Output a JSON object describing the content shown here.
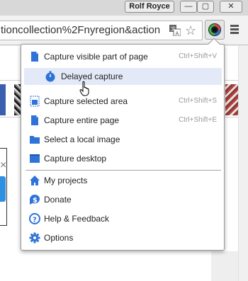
{
  "window": {
    "user_name": "Rolf Royce",
    "minimize_glyph": "—",
    "restore_glyph": "▢",
    "close_glyph": "✕"
  },
  "toolbar": {
    "url_text": "tioncollection%2Fnyregion&action",
    "star_glyph": "☆",
    "icons": [
      "translate-icon",
      "star-icon",
      "screenshot-extension-icon",
      "menu-icon"
    ]
  },
  "page": {
    "close_glyph": "×"
  },
  "popup": {
    "items": [
      {
        "label": "Capture visible part of page",
        "shortcut": "Ctrl+Shift+V",
        "icon": "page-icon"
      },
      {
        "label": "Delayed capture",
        "shortcut": "",
        "icon": "timer-icon"
      },
      {
        "label": "Capture selected area",
        "shortcut": "Ctrl+Shift+S",
        "icon": "selection-icon"
      },
      {
        "label": "Capture entire page",
        "shortcut": "Ctrl+Shift+E",
        "icon": "page-icon"
      },
      {
        "label": "Select a local image",
        "shortcut": "",
        "icon": "folder-icon"
      },
      {
        "label": "Capture desktop",
        "shortcut": "",
        "icon": "desktop-icon"
      },
      {
        "label": "My projects",
        "shortcut": "",
        "icon": "home-icon"
      },
      {
        "label": "Donate",
        "shortcut": "",
        "icon": "dollar-icon"
      },
      {
        "label": "Help & Feedback",
        "shortcut": "",
        "icon": "help-icon"
      },
      {
        "label": "Options",
        "shortcut": "",
        "icon": "gear-icon"
      }
    ],
    "hovered_index": 1
  },
  "colors": {
    "accent_blue": "#2f73d8",
    "hover_bg": "#e3e9f6"
  }
}
